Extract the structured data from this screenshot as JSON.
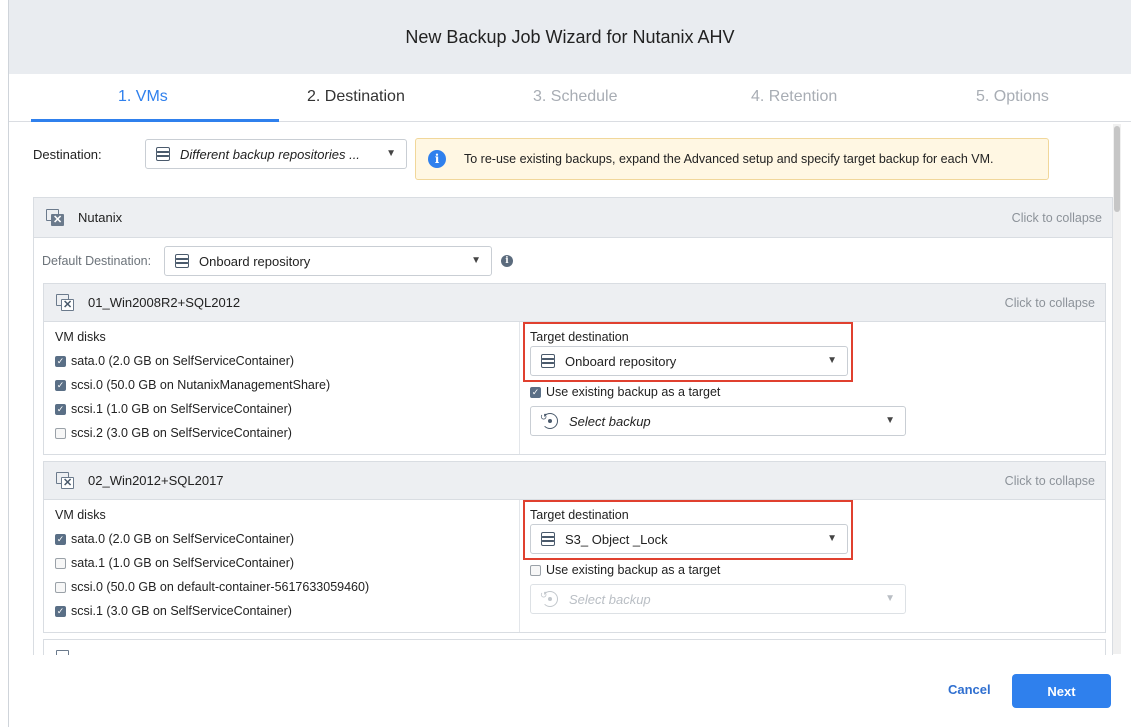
{
  "window": {
    "title": "New Backup Job Wizard for Nutanix AHV"
  },
  "steps": [
    {
      "label": "1. VMs"
    },
    {
      "label": "2. Destination"
    },
    {
      "label": "3. Schedule"
    },
    {
      "label": "4. Retention"
    },
    {
      "label": "5. Options"
    }
  ],
  "destination": {
    "label": "Destination:",
    "value": "Different backup repositories ..."
  },
  "info": {
    "text": "To re-use existing backups, expand the Advanced setup and specify target backup for each VM."
  },
  "cluster": {
    "name": "Nutanix",
    "collapse_label": "Click to collapse",
    "default_destination_label": "Default Destination:",
    "default_destination_value": "Onboard repository"
  },
  "vms": [
    {
      "name": "01_Win2008R2+SQL2012",
      "collapse_label": "Click to collapse",
      "disks_label": "VM disks",
      "disks": [
        {
          "label": "sata.0 (2.0 GB on SelfServiceContainer)",
          "checked": true
        },
        {
          "label": "scsi.0 (50.0 GB on NutanixManagementShare)",
          "checked": true
        },
        {
          "label": "scsi.1 (1.0 GB on SelfServiceContainer)",
          "checked": true
        },
        {
          "label": "scsi.2 (3.0 GB on SelfServiceContainer)",
          "checked": false
        }
      ],
      "target_label": "Target destination",
      "target_value": "Onboard repository",
      "use_existing_label": "Use existing backup as a target",
      "use_existing_checked": true,
      "backup_placeholder": "Select backup"
    },
    {
      "name": "02_Win2012+SQL2017",
      "collapse_label": "Click to collapse",
      "disks_label": "VM disks",
      "disks": [
        {
          "label": "sata.0 (2.0 GB on SelfServiceContainer)",
          "checked": true
        },
        {
          "label": "sata.1 (1.0 GB on SelfServiceContainer)",
          "checked": false
        },
        {
          "label": "scsi.0 (50.0 GB on default-container-5617633059460)",
          "checked": false
        },
        {
          "label": "scsi.1 (3.0 GB on SelfServiceContainer)",
          "checked": true
        }
      ],
      "target_label": "Target destination",
      "target_value": "S3_ Object _Lock",
      "use_existing_label": "Use existing backup as a target",
      "use_existing_checked": false,
      "backup_placeholder": "Select backup"
    }
  ],
  "footer": {
    "cancel_label": "Cancel",
    "next_label": "Next"
  },
  "colors": {
    "accent": "#2f80ed",
    "highlight": "#e0402f",
    "info_bg": "#fff7e3"
  }
}
